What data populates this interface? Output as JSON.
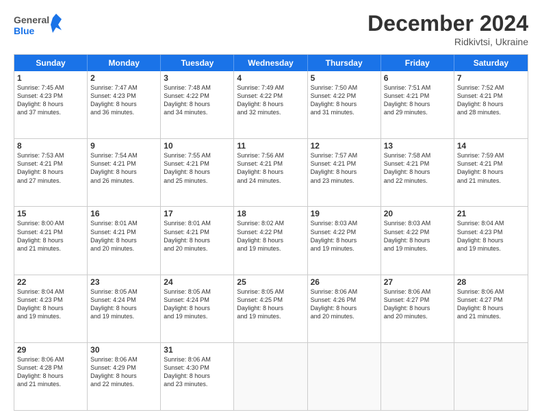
{
  "header": {
    "logo_line1": "General",
    "logo_line2": "Blue",
    "month": "December 2024",
    "location": "Ridkivtsi, Ukraine"
  },
  "weekdays": [
    "Sunday",
    "Monday",
    "Tuesday",
    "Wednesday",
    "Thursday",
    "Friday",
    "Saturday"
  ],
  "weeks": [
    [
      {
        "day": "1",
        "lines": [
          "Sunrise: 7:45 AM",
          "Sunset: 4:23 PM",
          "Daylight: 8 hours",
          "and 37 minutes."
        ]
      },
      {
        "day": "2",
        "lines": [
          "Sunrise: 7:47 AM",
          "Sunset: 4:23 PM",
          "Daylight: 8 hours",
          "and 36 minutes."
        ]
      },
      {
        "day": "3",
        "lines": [
          "Sunrise: 7:48 AM",
          "Sunset: 4:22 PM",
          "Daylight: 8 hours",
          "and 34 minutes."
        ]
      },
      {
        "day": "4",
        "lines": [
          "Sunrise: 7:49 AM",
          "Sunset: 4:22 PM",
          "Daylight: 8 hours",
          "and 32 minutes."
        ]
      },
      {
        "day": "5",
        "lines": [
          "Sunrise: 7:50 AM",
          "Sunset: 4:22 PM",
          "Daylight: 8 hours",
          "and 31 minutes."
        ]
      },
      {
        "day": "6",
        "lines": [
          "Sunrise: 7:51 AM",
          "Sunset: 4:21 PM",
          "Daylight: 8 hours",
          "and 29 minutes."
        ]
      },
      {
        "day": "7",
        "lines": [
          "Sunrise: 7:52 AM",
          "Sunset: 4:21 PM",
          "Daylight: 8 hours",
          "and 28 minutes."
        ]
      }
    ],
    [
      {
        "day": "8",
        "lines": [
          "Sunrise: 7:53 AM",
          "Sunset: 4:21 PM",
          "Daylight: 8 hours",
          "and 27 minutes."
        ]
      },
      {
        "day": "9",
        "lines": [
          "Sunrise: 7:54 AM",
          "Sunset: 4:21 PM",
          "Daylight: 8 hours",
          "and 26 minutes."
        ]
      },
      {
        "day": "10",
        "lines": [
          "Sunrise: 7:55 AM",
          "Sunset: 4:21 PM",
          "Daylight: 8 hours",
          "and 25 minutes."
        ]
      },
      {
        "day": "11",
        "lines": [
          "Sunrise: 7:56 AM",
          "Sunset: 4:21 PM",
          "Daylight: 8 hours",
          "and 24 minutes."
        ]
      },
      {
        "day": "12",
        "lines": [
          "Sunrise: 7:57 AM",
          "Sunset: 4:21 PM",
          "Daylight: 8 hours",
          "and 23 minutes."
        ]
      },
      {
        "day": "13",
        "lines": [
          "Sunrise: 7:58 AM",
          "Sunset: 4:21 PM",
          "Daylight: 8 hours",
          "and 22 minutes."
        ]
      },
      {
        "day": "14",
        "lines": [
          "Sunrise: 7:59 AM",
          "Sunset: 4:21 PM",
          "Daylight: 8 hours",
          "and 21 minutes."
        ]
      }
    ],
    [
      {
        "day": "15",
        "lines": [
          "Sunrise: 8:00 AM",
          "Sunset: 4:21 PM",
          "Daylight: 8 hours",
          "and 21 minutes."
        ]
      },
      {
        "day": "16",
        "lines": [
          "Sunrise: 8:01 AM",
          "Sunset: 4:21 PM",
          "Daylight: 8 hours",
          "and 20 minutes."
        ]
      },
      {
        "day": "17",
        "lines": [
          "Sunrise: 8:01 AM",
          "Sunset: 4:21 PM",
          "Daylight: 8 hours",
          "and 20 minutes."
        ]
      },
      {
        "day": "18",
        "lines": [
          "Sunrise: 8:02 AM",
          "Sunset: 4:22 PM",
          "Daylight: 8 hours",
          "and 19 minutes."
        ]
      },
      {
        "day": "19",
        "lines": [
          "Sunrise: 8:03 AM",
          "Sunset: 4:22 PM",
          "Daylight: 8 hours",
          "and 19 minutes."
        ]
      },
      {
        "day": "20",
        "lines": [
          "Sunrise: 8:03 AM",
          "Sunset: 4:22 PM",
          "Daylight: 8 hours",
          "and 19 minutes."
        ]
      },
      {
        "day": "21",
        "lines": [
          "Sunrise: 8:04 AM",
          "Sunset: 4:23 PM",
          "Daylight: 8 hours",
          "and 19 minutes."
        ]
      }
    ],
    [
      {
        "day": "22",
        "lines": [
          "Sunrise: 8:04 AM",
          "Sunset: 4:23 PM",
          "Daylight: 8 hours",
          "and 19 minutes."
        ]
      },
      {
        "day": "23",
        "lines": [
          "Sunrise: 8:05 AM",
          "Sunset: 4:24 PM",
          "Daylight: 8 hours",
          "and 19 minutes."
        ]
      },
      {
        "day": "24",
        "lines": [
          "Sunrise: 8:05 AM",
          "Sunset: 4:24 PM",
          "Daylight: 8 hours",
          "and 19 minutes."
        ]
      },
      {
        "day": "25",
        "lines": [
          "Sunrise: 8:05 AM",
          "Sunset: 4:25 PM",
          "Daylight: 8 hours",
          "and 19 minutes."
        ]
      },
      {
        "day": "26",
        "lines": [
          "Sunrise: 8:06 AM",
          "Sunset: 4:26 PM",
          "Daylight: 8 hours",
          "and 20 minutes."
        ]
      },
      {
        "day": "27",
        "lines": [
          "Sunrise: 8:06 AM",
          "Sunset: 4:27 PM",
          "Daylight: 8 hours",
          "and 20 minutes."
        ]
      },
      {
        "day": "28",
        "lines": [
          "Sunrise: 8:06 AM",
          "Sunset: 4:27 PM",
          "Daylight: 8 hours",
          "and 21 minutes."
        ]
      }
    ],
    [
      {
        "day": "29",
        "lines": [
          "Sunrise: 8:06 AM",
          "Sunset: 4:28 PM",
          "Daylight: 8 hours",
          "and 21 minutes."
        ]
      },
      {
        "day": "30",
        "lines": [
          "Sunrise: 8:06 AM",
          "Sunset: 4:29 PM",
          "Daylight: 8 hours",
          "and 22 minutes."
        ]
      },
      {
        "day": "31",
        "lines": [
          "Sunrise: 8:06 AM",
          "Sunset: 4:30 PM",
          "Daylight: 8 hours",
          "and 23 minutes."
        ]
      },
      null,
      null,
      null,
      null
    ]
  ]
}
